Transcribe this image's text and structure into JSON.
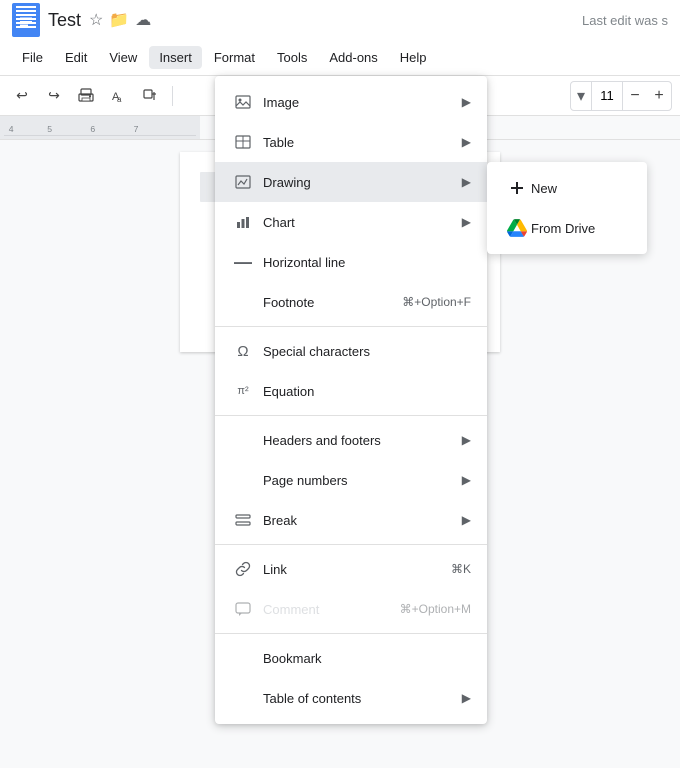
{
  "app": {
    "doc_icon_label": "Google Docs",
    "title": "Test",
    "star_icon": "★",
    "folder_icon": "📁",
    "cloud_icon": "☁",
    "last_edit": "Last edit was s"
  },
  "menubar": {
    "items": [
      {
        "label": "File",
        "active": false
      },
      {
        "label": "Edit",
        "active": false
      },
      {
        "label": "View",
        "active": false
      },
      {
        "label": "Insert",
        "active": true
      },
      {
        "label": "Format",
        "active": false
      },
      {
        "label": "Tools",
        "active": false
      },
      {
        "label": "Add-ons",
        "active": false
      },
      {
        "label": "Help",
        "active": false
      }
    ]
  },
  "toolbar": {
    "undo_label": "↩",
    "redo_label": "↪",
    "print_label": "🖨",
    "spell_label": "A",
    "paint_label": "🖌",
    "divider": true,
    "font_size": "11"
  },
  "insert_menu": {
    "items": [
      {
        "id": "image",
        "icon": "🖼",
        "label": "Image",
        "has_arrow": true,
        "disabled": false,
        "shortcut": ""
      },
      {
        "id": "table",
        "icon": "",
        "label": "Table",
        "has_arrow": true,
        "disabled": false,
        "shortcut": ""
      },
      {
        "id": "drawing",
        "icon": "",
        "label": "Drawing",
        "has_arrow": true,
        "disabled": false,
        "shortcut": "",
        "highlighted": true
      },
      {
        "id": "chart",
        "icon": "📊",
        "label": "Chart",
        "has_arrow": true,
        "disabled": false,
        "shortcut": ""
      },
      {
        "id": "horizontal_line",
        "icon": "—",
        "label": "Horizontal line",
        "has_arrow": false,
        "disabled": false,
        "shortcut": ""
      },
      {
        "id": "footnote",
        "icon": "",
        "label": "Footnote",
        "has_arrow": false,
        "disabled": false,
        "shortcut": "⌘+Option+F"
      },
      {
        "id": "special_chars",
        "icon": "Ω",
        "label": "Special characters",
        "has_arrow": false,
        "disabled": false,
        "shortcut": ""
      },
      {
        "id": "equation",
        "icon": "π²",
        "label": "Equation",
        "has_arrow": false,
        "disabled": false,
        "shortcut": ""
      },
      {
        "id": "headers_footers",
        "icon": "",
        "label": "Headers and footers",
        "has_arrow": true,
        "disabled": false,
        "shortcut": ""
      },
      {
        "id": "page_numbers",
        "icon": "",
        "label": "Page numbers",
        "has_arrow": true,
        "disabled": false,
        "shortcut": ""
      },
      {
        "id": "break",
        "icon": "⊟",
        "label": "Break",
        "has_arrow": true,
        "disabled": false,
        "shortcut": ""
      },
      {
        "id": "link",
        "icon": "🔗",
        "label": "Link",
        "has_arrow": false,
        "disabled": false,
        "shortcut": "⌘K"
      },
      {
        "id": "comment",
        "icon": "💬",
        "label": "Comment",
        "has_arrow": false,
        "disabled": true,
        "shortcut": "⌘+Option+M"
      },
      {
        "id": "bookmark",
        "icon": "",
        "label": "Bookmark",
        "has_arrow": false,
        "disabled": false,
        "shortcut": ""
      },
      {
        "id": "table_of_contents",
        "icon": "",
        "label": "Table of contents",
        "has_arrow": true,
        "disabled": false,
        "shortcut": ""
      }
    ]
  },
  "drawing_submenu": {
    "items": [
      {
        "id": "new",
        "label": "New",
        "icon": "+"
      },
      {
        "id": "from_drive",
        "label": "From Drive",
        "icon": "drive"
      }
    ]
  }
}
